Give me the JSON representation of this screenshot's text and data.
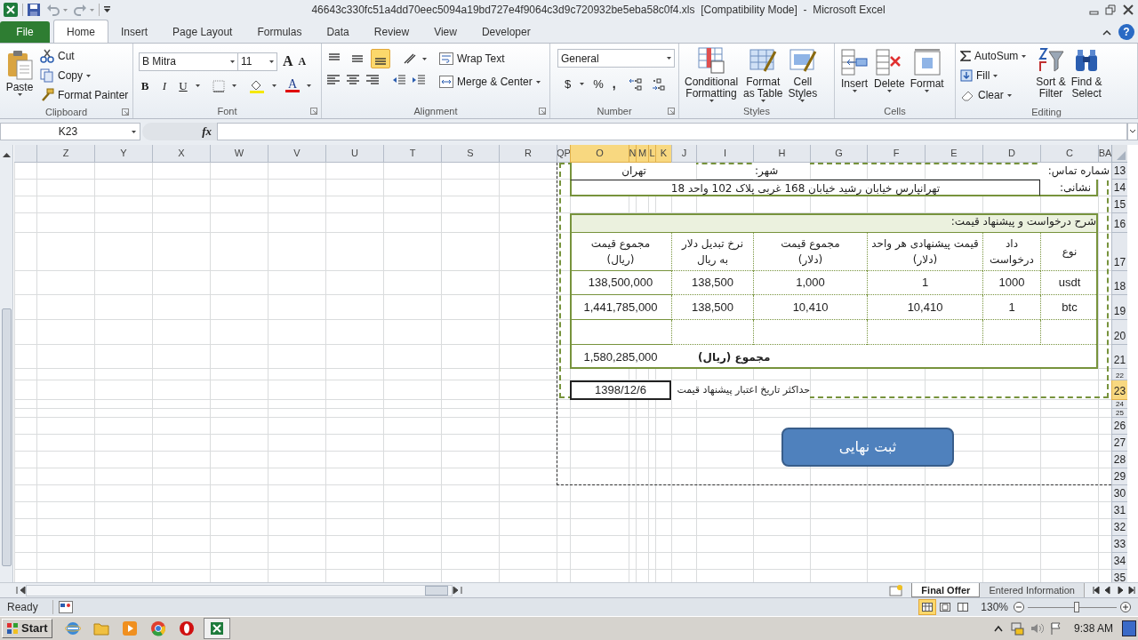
{
  "title_bar": {
    "title": "46643c330fc51a4dd70eec5094a19bd727e4f9064c3d9c720932be5eba58c0f4.xls  [Compatibility Mode]  -  Microsoft Excel"
  },
  "ribbon_tabs": [
    {
      "label": "File",
      "kind": "file",
      "selected": false
    },
    {
      "label": "Home",
      "kind": "tab",
      "selected": true
    },
    {
      "label": "Insert",
      "kind": "tab",
      "selected": false
    },
    {
      "label": "Page Layout",
      "kind": "tab",
      "selected": false
    },
    {
      "label": "Formulas",
      "kind": "tab",
      "selected": false
    },
    {
      "label": "Data",
      "kind": "tab",
      "selected": false
    },
    {
      "label": "Review",
      "kind": "tab",
      "selected": false
    },
    {
      "label": "View",
      "kind": "tab",
      "selected": false
    },
    {
      "label": "Developer",
      "kind": "tab",
      "selected": false
    }
  ],
  "help": "?",
  "ribbon": {
    "clipboard": {
      "label": "Clipboard",
      "paste": "Paste",
      "cut": "Cut",
      "copy": "Copy",
      "format_painter": "Format Painter"
    },
    "font": {
      "label": "Font",
      "font_name": "B Mitra",
      "font_size": "11",
      "grow": "A",
      "shrink": "A",
      "bold": "B",
      "italic": "I",
      "underline": "U",
      "font_color": "A"
    },
    "alignment": {
      "label": "Alignment",
      "vertical_align": [
        {
          "selected": false
        },
        {
          "selected": false
        },
        {
          "selected": true
        }
      ],
      "wrap_text": "Wrap Text",
      "merge_center": "Merge & Center"
    },
    "number": {
      "label": "Number",
      "format": "General",
      "currency": "$",
      "percent": "%",
      "comma": ","
    },
    "styles": {
      "label": "Styles",
      "buttons": [
        "Conditional\nFormatting",
        "Format\nas Table",
        "Cell\nStyles"
      ]
    },
    "cells": {
      "label": "Cells",
      "buttons": [
        "Insert",
        "Delete",
        "Format"
      ]
    },
    "editing": {
      "label": "Editing",
      "autosum": "AutoSum",
      "fill": "Fill",
      "clear": "Clear",
      "sort_filter": "Sort &\nFilter",
      "find_select": "Find &\nSelect"
    }
  },
  "name_box": "K23",
  "function_label": "fx",
  "sheet": {
    "columns": [
      {
        "label": "Z",
        "selected": false
      },
      {
        "label": "Y",
        "selected": false
      },
      {
        "label": "X",
        "selected": false
      },
      {
        "label": "W",
        "selected": false
      },
      {
        "label": "V",
        "selected": false
      },
      {
        "label": "U",
        "selected": false
      },
      {
        "label": "T",
        "selected": false
      },
      {
        "label": "S",
        "selected": false
      },
      {
        "label": "R",
        "selected": false
      },
      {
        "label": "QP",
        "selected": false
      },
      {
        "label": "O",
        "selected": true
      },
      {
        "label": "N",
        "selected": true
      },
      {
        "label": "M",
        "selected": true
      },
      {
        "label": "L",
        "selected": true
      },
      {
        "label": "K",
        "selected": true
      },
      {
        "label": "J",
        "selected": false
      },
      {
        "label": "I",
        "selected": false
      },
      {
        "label": "H",
        "selected": false
      },
      {
        "label": "G",
        "selected": false
      },
      {
        "label": "F",
        "selected": false
      },
      {
        "label": "E",
        "selected": false
      },
      {
        "label": "D",
        "selected": false
      },
      {
        "label": "C",
        "selected": false
      },
      {
        "label": "BA",
        "selected": false
      }
    ],
    "rows": [
      {
        "label": "13",
        "selected": false
      },
      {
        "label": "14",
        "selected": false
      },
      {
        "label": "15",
        "selected": false
      },
      {
        "label": "16",
        "selected": false
      },
      {
        "label": "17",
        "selected": false
      },
      {
        "label": "18",
        "selected": false
      },
      {
        "label": "19",
        "selected": false
      },
      {
        "label": "20",
        "selected": false
      },
      {
        "label": "21",
        "selected": false
      },
      {
        "label": "22",
        "selected": false
      },
      {
        "label": "23",
        "selected": true
      },
      {
        "label": "24",
        "selected": false
      },
      {
        "label": "25",
        "selected": false
      },
      {
        "label": "26",
        "selected": false
      },
      {
        "label": "27",
        "selected": false
      },
      {
        "label": "28",
        "selected": false
      },
      {
        "label": "29",
        "selected": false
      },
      {
        "label": "30",
        "selected": false
      },
      {
        "label": "31",
        "selected": false
      },
      {
        "label": "32",
        "selected": false
      },
      {
        "label": "33",
        "selected": false
      },
      {
        "label": "34",
        "selected": false
      },
      {
        "label": "35",
        "selected": false
      }
    ]
  },
  "contact": {
    "city": "تهران",
    "city_label": "شهر:",
    "phone_label": "شماره تماس:",
    "address": "تهرانپارس خیابان رشید خیابان 168 غربی پلاک 102 واحد 18",
    "address_label": "نشانی:"
  },
  "request": {
    "title": "شرح درخواست و پیشنهاد قیمت:",
    "columns": [
      "مجموع قیمت\n(ریال)",
      "نرخ تبدیل دلار\nبه ریال",
      "مجموع قیمت\n(دلار)",
      "قیمت پیشنهادی هر واحد\n(دلار)",
      "داد درخواست",
      "نوع"
    ],
    "rows": [
      [
        "138,500,000",
        "138,500",
        "1,000",
        "1",
        "1000",
        "usdt"
      ],
      [
        "1,441,785,000",
        "138,500",
        "10,410",
        "10,410",
        "1",
        "btc"
      ]
    ],
    "total": "1,580,285,000",
    "total_label": "مجموع (ریال)"
  },
  "validity": {
    "date": "1398/12/6",
    "label": "حداکثر تاریخ اعتبار پیشنهاد قیمت"
  },
  "submit_button": "ثبت نهایی",
  "sheet_tabs": [
    {
      "label": "Final Offer",
      "selected": true
    },
    {
      "label": "Entered Information",
      "selected": false
    }
  ],
  "status_bar": {
    "status": "Ready",
    "views": [
      {
        "selected": true
      },
      {
        "selected": false
      },
      {
        "selected": false
      }
    ],
    "zoom": "130%",
    "zoom_level": {
      "level": 0.55
    }
  },
  "taskbar": {
    "start": "Start",
    "clock": "9:38 AM"
  }
}
